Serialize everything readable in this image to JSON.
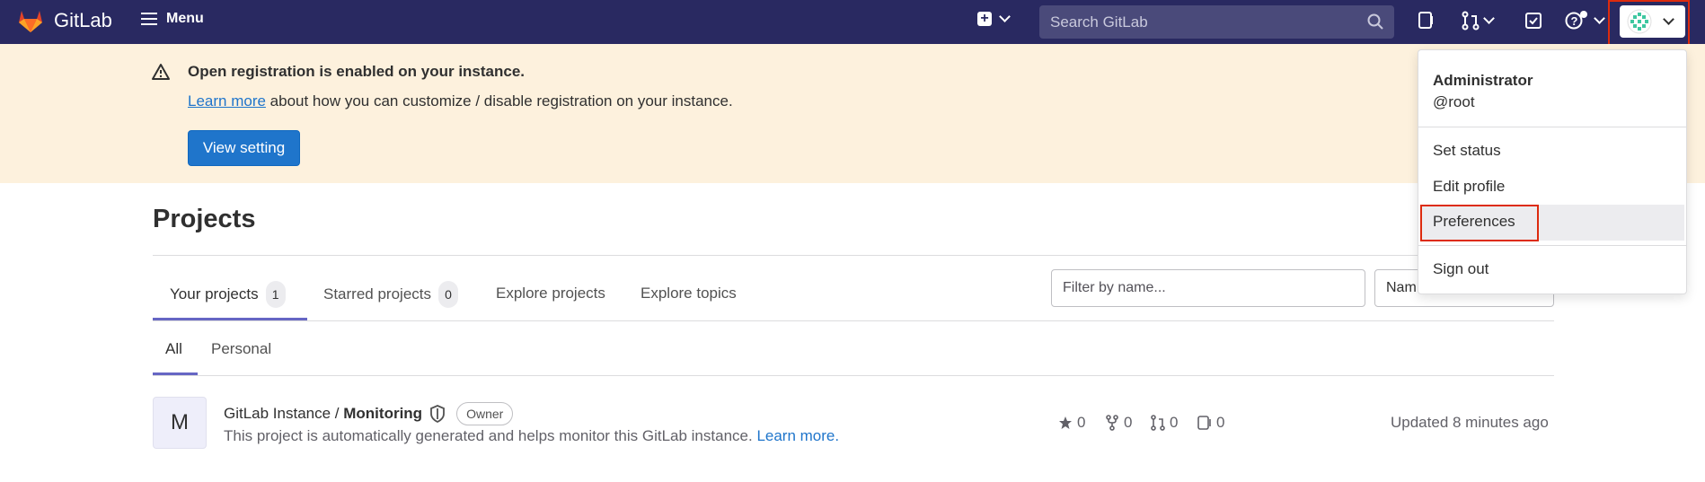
{
  "topbar": {
    "brand": "GitLab",
    "menu_label": "Menu",
    "search_placeholder": "Search GitLab"
  },
  "banner": {
    "title": "Open registration is enabled on your instance.",
    "link_text": "Learn more",
    "text": " about how you can customize / disable registration on your instance.",
    "button_label": "View setting"
  },
  "main": {
    "title": "Projects",
    "tabs": [
      {
        "label": "Your projects",
        "count": "1"
      },
      {
        "label": "Starred projects",
        "count": "0"
      },
      {
        "label": "Explore projects"
      },
      {
        "label": "Explore topics"
      }
    ],
    "filter_placeholder": "Filter by name...",
    "sort_value": "Nam",
    "subtabs": [
      "All",
      "Personal"
    ]
  },
  "project": {
    "avatar_letter": "M",
    "namespace": "GitLab Instance / ",
    "name": "Monitoring",
    "badge": "Owner",
    "description": "This project is automatically generated and helps monitor this GitLab instance. ",
    "description_link": "Learn more.",
    "stars": "0",
    "forks": "0",
    "merge_requests": "0",
    "issues": "0",
    "updated": "Updated 8 minutes ago"
  },
  "user_menu": {
    "name": "Administrator",
    "username": "@root",
    "items": [
      "Set status",
      "Edit profile",
      "Preferences",
      "Sign out"
    ]
  },
  "colors": {
    "nav_bg": "#292961",
    "banner_bg": "#fdf1dd",
    "primary": "#1f75cb",
    "tab_underline": "#6666c4",
    "highlight": "#dd2b0e"
  }
}
